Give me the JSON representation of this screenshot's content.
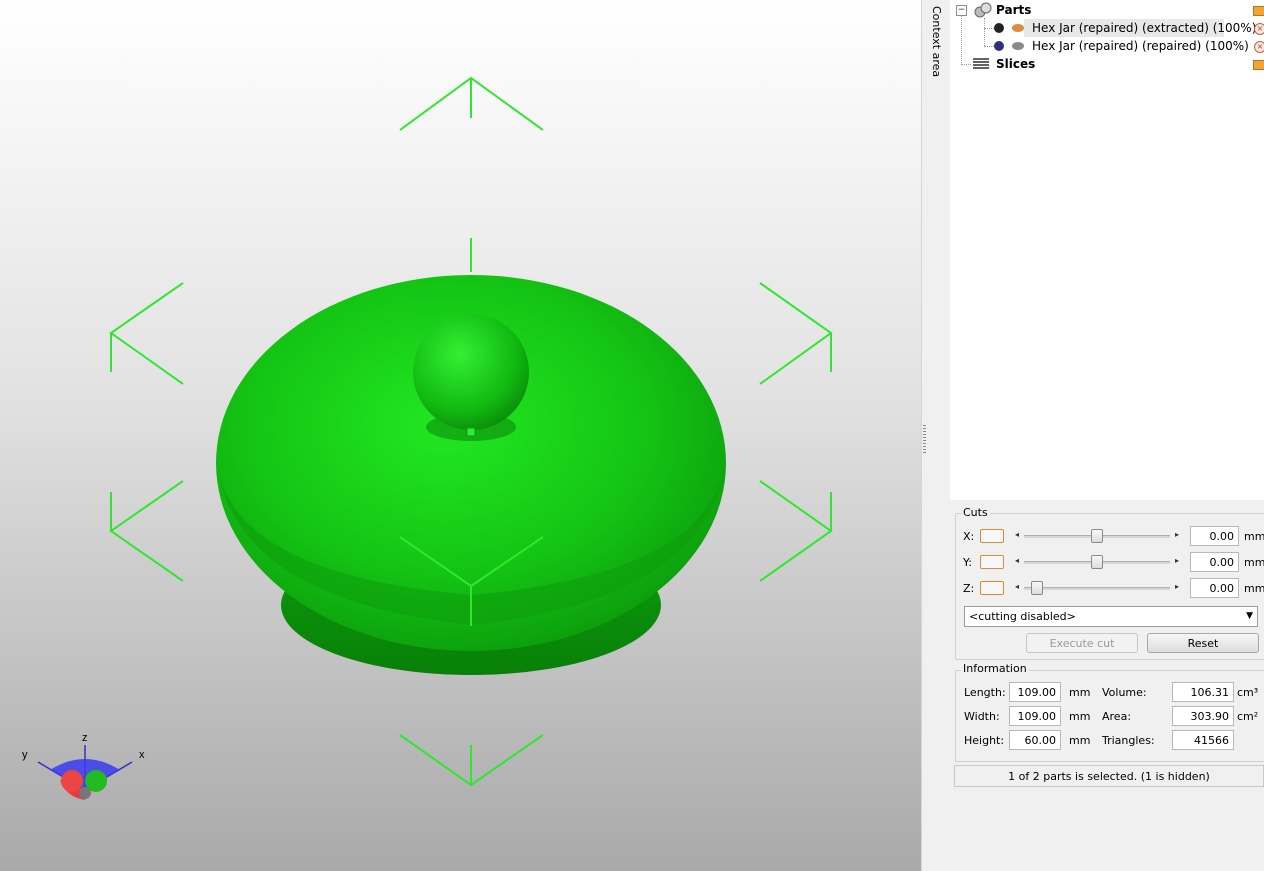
{
  "context_area_label": "Context area",
  "tree": {
    "parts_label": "Parts",
    "items": [
      {
        "label": "Hex Jar (repaired) (extracted) (100%)",
        "dot_color": "#222222",
        "eye_color": "#e08a3a"
      },
      {
        "label": "Hex Jar (repaired) (repaired) (100%)",
        "dot_color": "#303080",
        "eye_color": "#8a8a8a"
      }
    ],
    "slices_label": "Slices"
  },
  "cuts": {
    "title": "Cuts",
    "rows": [
      {
        "axis": "X:",
        "value": "0.00",
        "unit": "mm",
        "slider_pos": 0.5
      },
      {
        "axis": "Y:",
        "value": "0.00",
        "unit": "mm",
        "slider_pos": 0.5
      },
      {
        "axis": "Z:",
        "value": "0.00",
        "unit": "mm",
        "slider_pos": 0.0
      }
    ],
    "mode": "<cutting disabled>",
    "execute_label": "Execute cut",
    "reset_label": "Reset"
  },
  "information": {
    "title": "Information",
    "length_label": "Length:",
    "length_value": "109.00",
    "length_unit": "mm",
    "width_label": "Width:",
    "width_value": "109.00",
    "width_unit": "mm",
    "height_label": "Height:",
    "height_value": "60.00",
    "height_unit": "mm",
    "volume_label": "Volume:",
    "volume_value": "106.31",
    "volume_unit": "cm³",
    "area_label": "Area:",
    "area_value": "303.90",
    "area_unit": "cm²",
    "triangles_label": "Triangles:",
    "triangles_value": "41566"
  },
  "status": "1 of 2 parts is selected. (1 is hidden)",
  "axes": {
    "x": "x",
    "y": "y",
    "z": "z"
  },
  "colors": {
    "model": "#1ec81e",
    "bbox": "#2ee82e"
  }
}
